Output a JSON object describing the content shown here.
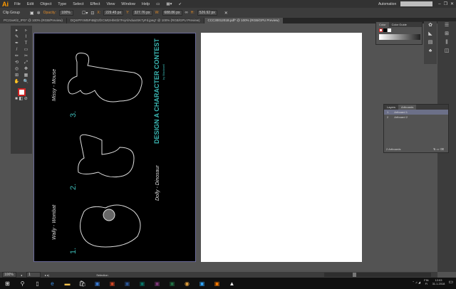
{
  "app": {
    "logo": "Ai",
    "menus": [
      "File",
      "Edit",
      "Object",
      "Type",
      "Select",
      "Effect",
      "View",
      "Window",
      "Help"
    ],
    "workspace": "Automation",
    "search_placeholder": ""
  },
  "control": {
    "selection": "Clip Group",
    "opacity_label": "Opacity:",
    "opacity": "100%",
    "x": "229.45 px",
    "y": "327.76 px",
    "w": "688.86 px",
    "h": "526.92 px"
  },
  "tabs": [
    "PC21wKl2_IPG* @ 100% (RGB/Preview)",
    "DQmPFrWt5P4BjD2fzCWt2HhKtb7FejAfAduarSK7yFd.jpeg* @ 100% (RGB/GPU Preview)",
    "CCC3001201B.pdf* @ 100% (RGB/GPU Preview)"
  ],
  "tools": [
    "▸",
    "▹",
    "✎",
    "⌇",
    "✒",
    "T",
    "/",
    "▭",
    "✏",
    "✂",
    "⟲",
    "⤢",
    "◎",
    "✥",
    "⊞",
    "▦",
    "✋",
    "🔍"
  ],
  "color_panel": {
    "tabs": [
      "Color",
      "Color Guide"
    ]
  },
  "artboards_panel": {
    "tabs": [
      "Layers",
      "Artboards"
    ],
    "rows": [
      {
        "num": "1",
        "name": "Artboard 1"
      },
      {
        "num": "2",
        "name": "Artboard 2"
      }
    ],
    "footer": "2 Artboards"
  },
  "artwork": {
    "title": "DESIGN A CHARACTER CONTEST",
    "byline": "by Blackwell",
    "labels": [
      "1.",
      "2.",
      "3."
    ],
    "names": [
      "Wally - Wombat",
      "Dolly - Dinosaur",
      "Missy - Mouse"
    ]
  },
  "status": {
    "zoom": "100%",
    "page": "1",
    "tool": "Selection"
  },
  "taskbar": {
    "lang": "FIN",
    "day": "Fi",
    "time": "12:03",
    "date": "31.1.2018"
  }
}
